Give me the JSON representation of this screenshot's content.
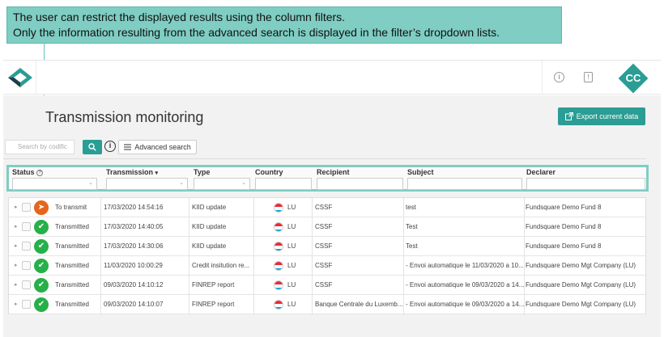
{
  "callout": {
    "line1": "The user can restrict the displayed results using the column filters.",
    "line2": "Only the information resulting from the advanced search is displayed in the filter’s dropdown lists."
  },
  "topbar": {
    "info_icon": "info-circle-icon",
    "doc_icon": "document-icon",
    "avatar_initials": "CC",
    "accent": "#2a9d94"
  },
  "page": {
    "title": "Transmission monitoring",
    "export_label": "Export current data"
  },
  "search": {
    "placeholder": "Search by codific",
    "advanced_label": "Advanced search"
  },
  "filters": {
    "columns": [
      {
        "label": "Status",
        "has_help": true
      },
      {
        "label": "Transmission",
        "sorted": "desc"
      },
      {
        "label": "Type"
      },
      {
        "label": "Country"
      },
      {
        "label": "Recipient"
      },
      {
        "label": "Subject"
      },
      {
        "label": "Declarer"
      }
    ],
    "status_label": "Status",
    "transmission_label": "Transmission",
    "type_label": "Type",
    "country_label": "Country",
    "recipient_label": "Recipient",
    "subject_label": "Subject",
    "declarer_label": "Declarer",
    "highlight_color": "#7fcdc3"
  },
  "rows": [
    {
      "status": "To transmit",
      "status_color": "#e8641b",
      "icon": "send-icon",
      "date": "17/03/2020 14:54:16",
      "type": "KIID update",
      "country": "LU",
      "recipient": "CSSF",
      "subject": "test",
      "declarer": "Fundsquare Demo Fund 8"
    },
    {
      "status": "Transmitted",
      "status_color": "#27b04a",
      "icon": "check-send-icon",
      "date": "17/03/2020 14:40:05",
      "type": "KIID update",
      "country": "LU",
      "recipient": "CSSF",
      "subject": "Test",
      "declarer": "Fundsquare Demo Fund 8"
    },
    {
      "status": "Transmitted",
      "status_color": "#27b04a",
      "icon": "check-send-icon",
      "date": "17/03/2020 14:30:06",
      "type": "KIID update",
      "country": "LU",
      "recipient": "CSSF",
      "subject": "Test",
      "declarer": "Fundsquare Demo Fund 8"
    },
    {
      "status": "Transmitted",
      "status_color": "#27b04a",
      "icon": "check-send-icon",
      "date": "11/03/2020 10:00:29",
      "type": "Credit insitution re...",
      "country": "LU",
      "recipient": "CSSF",
      "subject": "- Envoi automatique le 11/03/2020 a 10...",
      "declarer": "Fundsquare Demo Mgt Company (LU)"
    },
    {
      "status": "Transmitted",
      "status_color": "#27b04a",
      "icon": "check-send-icon",
      "date": "09/03/2020 14:10:12",
      "type": "FINREP report",
      "country": "LU",
      "recipient": "CSSF",
      "subject": "- Envoi automatique le 09/03/2020 a 14...",
      "declarer": "Fundsquare Demo Mgt Company (LU)"
    },
    {
      "status": "Transmitted",
      "status_color": "#27b04a",
      "icon": "check-send-icon",
      "date": "09/03/2020 14:10:07",
      "type": "FINREP report",
      "country": "LU",
      "recipient": "Banque Centrale du Luxemb...",
      "subject": "- Envoi automatique le 09/03/2020 a 14...",
      "declarer": "Fundsquare Demo Mgt Company (LU)"
    }
  ]
}
